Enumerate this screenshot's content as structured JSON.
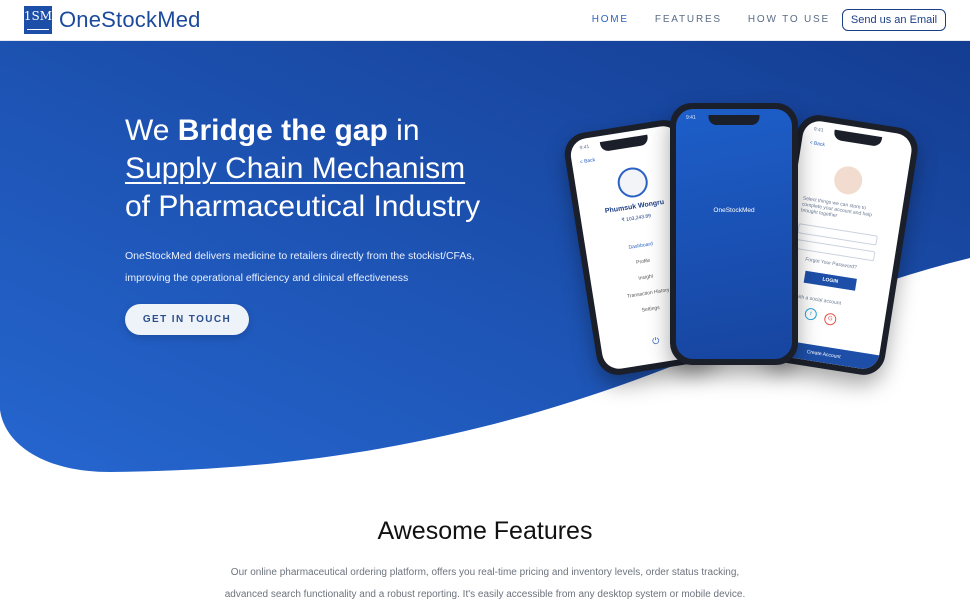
{
  "brand": {
    "logo_mark": "1SM",
    "name": "OneStockMed",
    "primary_color": "#1d4fa8"
  },
  "nav": {
    "items": [
      {
        "label": "HOME",
        "active": true
      },
      {
        "label": "FEATURES",
        "active": false
      },
      {
        "label": "HOW TO USE",
        "active": false
      }
    ],
    "email_button": "Send us an Email"
  },
  "hero": {
    "title_line1_pre": "We ",
    "title_line1_bold": "Bridge the gap",
    "title_line1_post": " in",
    "title_line2": "Supply Chain Mechanism",
    "title_line3": "of Pharmaceutical Industry",
    "description_line1": "OneStockMed delivers medicine to retailers directly from the stockist/CFAs,",
    "description_line2": "improving the operational efficiency and clinical effectiveness",
    "cta": "GET IN TOUCH",
    "gradient_start": "#2160c8",
    "gradient_end": "#163e93"
  },
  "phones": {
    "left": {
      "time": "9:41",
      "back": "< Back",
      "profile_name": "Phumsuk Wongru",
      "profile_sub": "₹ 103,243.89",
      "menu": [
        "Dashboard",
        "Profile",
        "Insight",
        "Transaction History",
        "Settings"
      ]
    },
    "center": {
      "time": "9:41",
      "label": "OneStockMed"
    },
    "right": {
      "time": "9:41",
      "back": "< Back",
      "intro": "Select things we can store to complete your account and help brought together",
      "forgot": "Forgot Your Password?",
      "login_button": "LOGIN",
      "social_text": "with a social account",
      "footer_text": "Create Account"
    }
  },
  "features": {
    "title": "Awesome Features",
    "description_line1": "Our online pharmaceutical ordering platform, offers you real-time pricing and inventory levels, order status tracking,",
    "description_line2": "advanced search functionality and a robust reporting. It's easily accessible from any desktop system or mobile device. With"
  }
}
